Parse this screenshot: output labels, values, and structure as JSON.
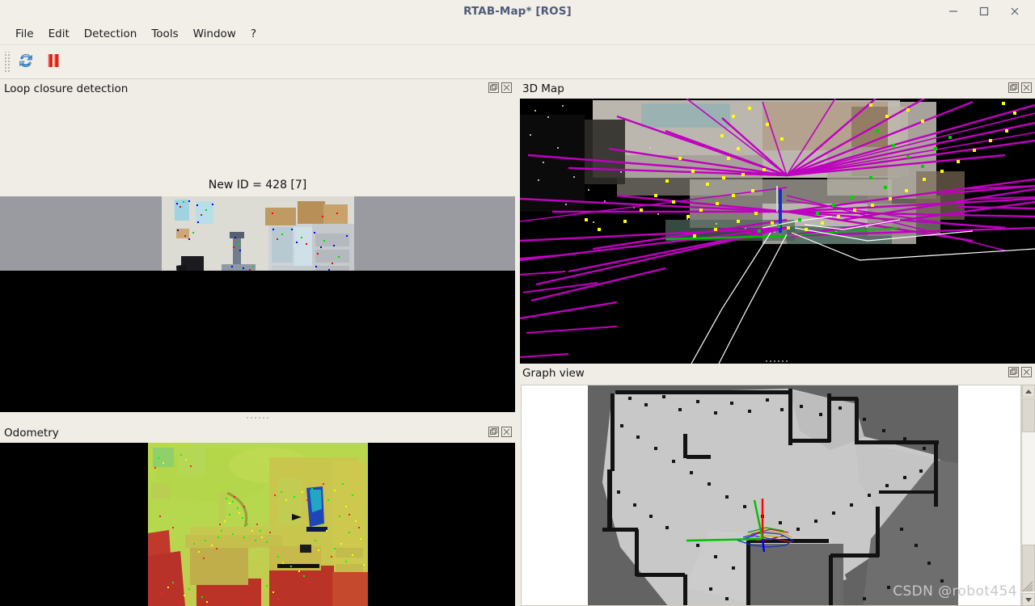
{
  "window": {
    "title": "RTAB-Map* [ROS]",
    "controls": [
      {
        "name": "minimize-button",
        "label": "—"
      },
      {
        "name": "maximize-button",
        "label": "□"
      },
      {
        "name": "close-button",
        "label": "✕"
      }
    ]
  },
  "menubar": {
    "items": [
      {
        "label": "File"
      },
      {
        "label": "Edit"
      },
      {
        "label": "Detection"
      },
      {
        "label": "Tools"
      },
      {
        "label": "Window"
      },
      {
        "label": "?"
      }
    ]
  },
  "toolbar": {
    "buttons": [
      {
        "name": "refresh-icon",
        "tooltip": "Start / Refresh"
      },
      {
        "name": "pause-icon",
        "tooltip": "Pause"
      }
    ]
  },
  "panels": {
    "loop_closure": {
      "title": "Loop closure detection",
      "status": "New ID = 428 [7]",
      "float_label": "float",
      "close_label": "close"
    },
    "odometry": {
      "title": "Odometry",
      "float_label": "float",
      "close_label": "close"
    },
    "map3d": {
      "title": "3D Map",
      "float_label": "float",
      "close_label": "close"
    },
    "graph_view": {
      "title": "Graph view",
      "float_label": "float",
      "close_label": "close"
    }
  },
  "watermark": {
    "text": "CSDN @robot454"
  },
  "colors": {
    "title_text": "#4e5a77",
    "chrome": "#f0ede7",
    "loop_link": "#c000c0",
    "feature_yellow": "#ffff00",
    "feature_green": "#00c000",
    "axis_x": "#ff0000",
    "axis_y": "#00ff00",
    "axis_z": "#0000ff",
    "grid_free": "#c8c8c8",
    "grid_unknown": "#636363",
    "grid_occupied": "#000000"
  }
}
